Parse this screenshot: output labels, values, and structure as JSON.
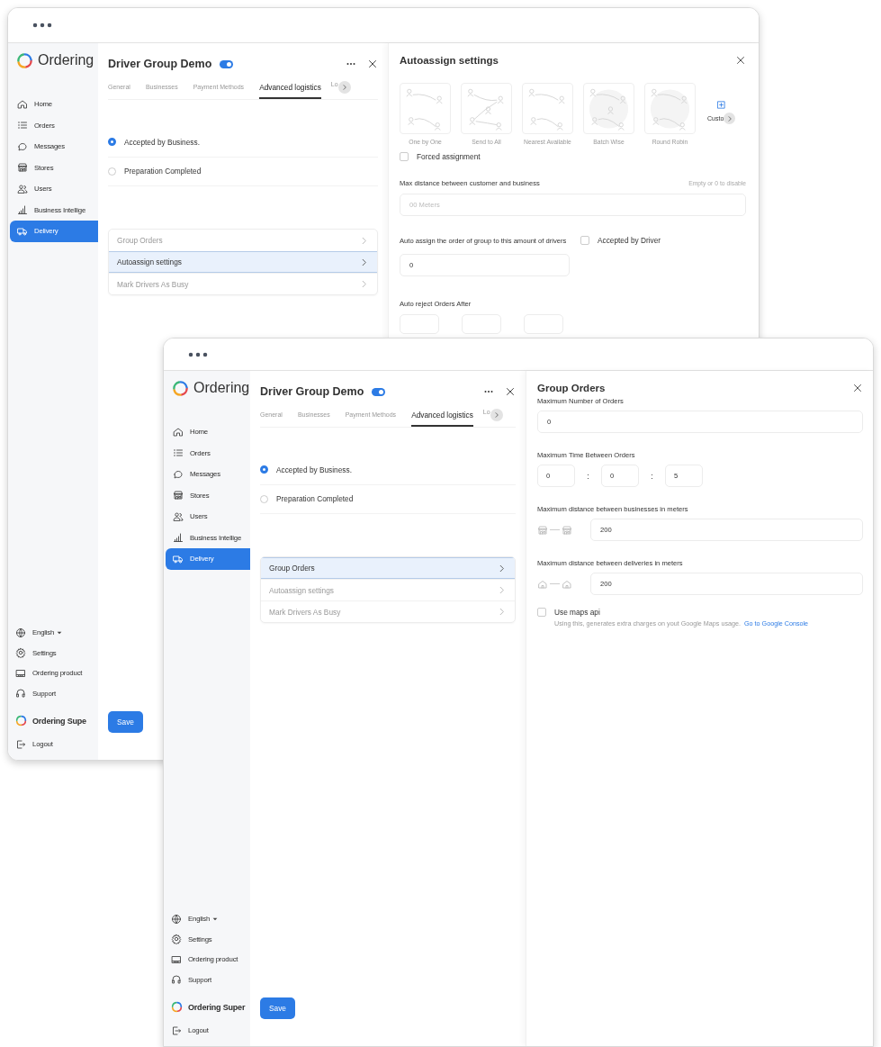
{
  "windows": [
    {
      "brand": "Ordering",
      "nav": [
        {
          "label": "Home",
          "selected": false
        },
        {
          "label": "Orders",
          "selected": false
        },
        {
          "label": "Messages",
          "selected": false
        },
        {
          "label": "Stores",
          "selected": false
        },
        {
          "label": "Users",
          "selected": false
        },
        {
          "label": "Business Intellige",
          "selected": false
        },
        {
          "label": "Delivery",
          "selected": true
        }
      ],
      "footer": [
        {
          "label": "English",
          "kind": "dropdown"
        },
        {
          "label": "Settings",
          "kind": "link"
        },
        {
          "label": "Ordering product",
          "kind": "link"
        },
        {
          "label": "Support",
          "kind": "link"
        },
        {
          "label": "Ordering Supe",
          "kind": "account"
        },
        {
          "label": "Logout",
          "kind": "link"
        }
      ],
      "group": {
        "title": "Driver Group Demo",
        "enabled": true
      },
      "tabs": [
        {
          "label": "General",
          "selected": false
        },
        {
          "label": "Businesses",
          "selected": false
        },
        {
          "label": "Payment Methods",
          "selected": false
        },
        {
          "label": "Advanced logistics",
          "selected": true
        },
        {
          "label": "Lo",
          "selected": false
        }
      ],
      "radios": [
        {
          "label": "Accepted by Business.",
          "selected": true
        },
        {
          "label": "Preparation Completed",
          "selected": false
        }
      ],
      "menu": [
        {
          "label": "Group Orders",
          "selected": false
        },
        {
          "label": "Autoassign settings",
          "selected": true
        },
        {
          "label": "Mark Drivers As Busy",
          "selected": false
        }
      ],
      "save": "Save",
      "panel": {
        "kind": "autoassign",
        "title": "Autoassign settings",
        "strategies": [
          {
            "label": "One by One"
          },
          {
            "label": "Send to All"
          },
          {
            "label": "Nearest Available"
          },
          {
            "label": "Batch Wise"
          },
          {
            "label": "Round Robin"
          }
        ],
        "custom": "Custo",
        "forced": {
          "label": "Forced assignment",
          "checked": false
        },
        "max_distance": {
          "label": "Max distance between customer and business",
          "hint": "Empty or 0 to disable",
          "placeholder": "00 Meters"
        },
        "auto_assign": {
          "label": "Auto assign the order of group to this amount of drivers",
          "value": "0"
        },
        "accepted_by_driver": {
          "label": "Accepted by Driver",
          "checked": false
        },
        "auto_reject": {
          "label": "Auto reject Orders After"
        }
      }
    },
    {
      "brand": "Ordering",
      "nav": [
        {
          "label": "Home",
          "selected": false
        },
        {
          "label": "Orders",
          "selected": false
        },
        {
          "label": "Messages",
          "selected": false
        },
        {
          "label": "Stores",
          "selected": false
        },
        {
          "label": "Users",
          "selected": false
        },
        {
          "label": "Business Intellige",
          "selected": false
        },
        {
          "label": "Delivery",
          "selected": true
        }
      ],
      "footer": [
        {
          "label": "English",
          "kind": "dropdown"
        },
        {
          "label": "Settings",
          "kind": "link"
        },
        {
          "label": "Ordering product",
          "kind": "link"
        },
        {
          "label": "Support",
          "kind": "link"
        },
        {
          "label": "Ordering Super",
          "kind": "account"
        },
        {
          "label": "Logout",
          "kind": "link"
        }
      ],
      "group": {
        "title": "Driver Group Demo",
        "enabled": true
      },
      "tabs": [
        {
          "label": "General",
          "selected": false
        },
        {
          "label": "Businesses",
          "selected": false
        },
        {
          "label": "Payment Methods",
          "selected": false
        },
        {
          "label": "Advanced logistics",
          "selected": true
        },
        {
          "label": "Lo",
          "selected": false
        }
      ],
      "radios": [
        {
          "label": "Accepted by Business.",
          "selected": true
        },
        {
          "label": "Preparation Completed",
          "selected": false
        }
      ],
      "menu": [
        {
          "label": "Group Orders",
          "selected": true
        },
        {
          "label": "Autoassign settings",
          "selected": false
        },
        {
          "label": "Mark Drivers As Busy",
          "selected": false
        }
      ],
      "save": "Save",
      "panel": {
        "kind": "group_orders",
        "title": "Group Orders",
        "max_orders": {
          "label": "Maximum Number of Orders",
          "value": "0"
        },
        "max_time": {
          "label": "Maximum Time Between Orders",
          "values": [
            "0",
            "0",
            "5"
          ],
          "separator": ":"
        },
        "business_distance": {
          "label": "Maximum distance between businesses in meters",
          "value": "200"
        },
        "delivery_distance": {
          "label": "Maximum distance between deliveries in meters",
          "value": "200"
        },
        "maps_api": {
          "label": "Use maps api",
          "checked": false,
          "note": "Using this, generates extra charges on yout Google Maps usage.",
          "link": "Go to Google Console"
        }
      }
    }
  ]
}
